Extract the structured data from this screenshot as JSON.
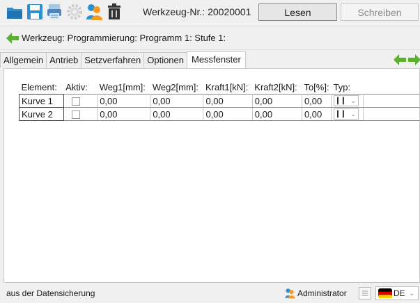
{
  "header": {
    "title": "Werkzeug-Nr.: 20020001",
    "read_button": "Lesen",
    "write_button": "Schreiben"
  },
  "breadcrumb": {
    "path": "Werkzeug: Programmierung: Programm 1: Stufe 1:"
  },
  "tabs": [
    {
      "label": "Allgemein"
    },
    {
      "label": "Antrieb"
    },
    {
      "label": "Setzverfahren"
    },
    {
      "label": "Optionen"
    },
    {
      "label": "Messfenster"
    }
  ],
  "active_tab": "Messfenster",
  "table": {
    "headers": [
      "Element:",
      "Aktiv:",
      "Weg1[mm]:",
      "Weg2[mm]:",
      "Kraft1[kN]:",
      "Kraft2[kN]:",
      "To[%]:",
      "Typ:"
    ],
    "rows": [
      {
        "element": "Kurve 1",
        "weg1": "0,00",
        "weg2": "0,00",
        "kraft1": "0,00",
        "kraft2": "0,00",
        "to": "0,00"
      },
      {
        "element": "Kurve 2",
        "weg1": "0,00",
        "weg2": "0,00",
        "kraft1": "0,00",
        "kraft2": "0,00",
        "to": "0,00"
      }
    ]
  },
  "status": {
    "message": "aus der Datensicherung",
    "user": "Administrator",
    "language": "DE"
  },
  "colors": {
    "accent_blue": "#2d8fd0",
    "arrow_green": "#5bb12f",
    "user_orange": "#f29a22"
  },
  "icons": [
    "folder-open-icon",
    "save-icon",
    "print-icon",
    "settings-icon",
    "user-icon",
    "delete-icon",
    "back-arrow-icon",
    "prev-arrow-icon",
    "next-arrow-icon",
    "user-icon",
    "document-icon",
    "flag-icon",
    "chevron-down-icon"
  ]
}
